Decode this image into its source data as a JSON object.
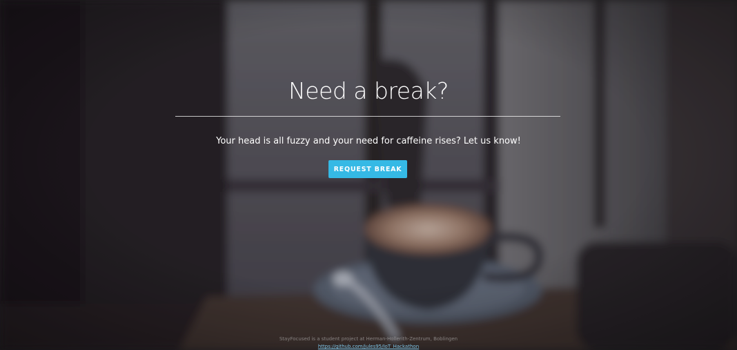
{
  "hero": {
    "headline": "Need a break?",
    "subtitle": "Your head is all fuzzy and your need for caffeine rises? Let us know!",
    "button_label": "REQUEST BREAK"
  },
  "footer": {
    "text": "StayFocused is a student project at Herman-Hollerith-Zentrum, Boblingen",
    "link": "https://github.com/jules95/IoT_Hackathon"
  },
  "colors": {
    "accent": "#35b9e5",
    "text": "#ffffff",
    "background": "#2b2a2c"
  }
}
